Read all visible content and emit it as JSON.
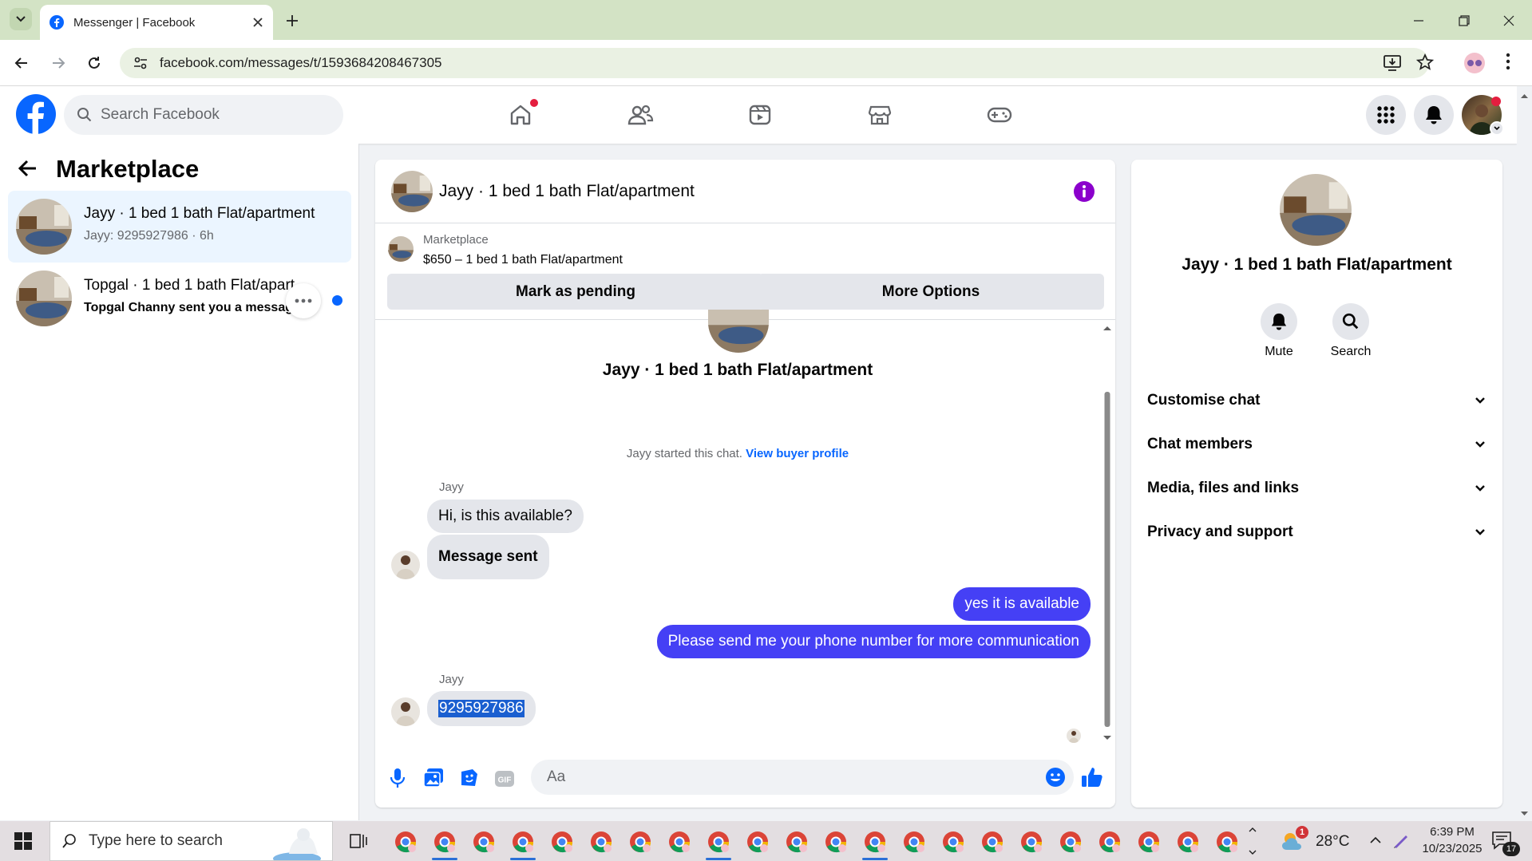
{
  "browser": {
    "tab_title": "Messenger | Facebook",
    "url": "facebook.com/messages/t/1593684208467305"
  },
  "fb": {
    "search_placeholder": "Search Facebook"
  },
  "left": {
    "title": "Marketplace",
    "conversations": [
      {
        "title": "Jayy · 1 bed 1 bath Flat/apartment",
        "subtitle": "Jayy: 9295927986 · 6h",
        "active": true
      },
      {
        "title": "Topgal · 1 bed 1 bath Flat/apart",
        "subtitle": "Topgal Channy sent you a messag...",
        "unread": true
      }
    ]
  },
  "chat": {
    "title": "Jayy · 1 bed 1 bath Flat/apartment",
    "listing_label": "Marketplace",
    "listing_price": "$650 – 1 bed 1 bath Flat/apartment",
    "mark_pending": "Mark as pending",
    "more_options": "More Options",
    "intro_name": "Jayy · 1 bed 1 bath Flat/apartment",
    "started": "Jayy started this chat.",
    "view_profile": "View buyer profile",
    "messages": [
      {
        "sender": "Jayy",
        "text": "Hi, is this available?",
        "dir": "in"
      },
      {
        "text": "Message sent",
        "dir": "in"
      },
      {
        "text": "yes it is available",
        "dir": "out"
      },
      {
        "text": "Please send me your phone number for more communication",
        "dir": "out"
      },
      {
        "sender": "Jayy",
        "text": "9295927986",
        "dir": "in"
      }
    ],
    "input_placeholder": "Aa"
  },
  "right": {
    "name": "Jayy · 1 bed 1 bath Flat/apartment",
    "mute": "Mute",
    "search": "Search",
    "sections": [
      "Customise chat",
      "Chat members",
      "Media, files and links",
      "Privacy and support"
    ]
  },
  "taskbar": {
    "search_placeholder": "Type here to search",
    "temp": "28°C",
    "weather_badge": "1",
    "time": "6:39 PM",
    "date": "10/23/2025",
    "notif_count": "17"
  },
  "colors": {
    "fb_blue": "#0866ff",
    "bubble_out": "#4540f5",
    "info_purple": "#8b00cc"
  }
}
